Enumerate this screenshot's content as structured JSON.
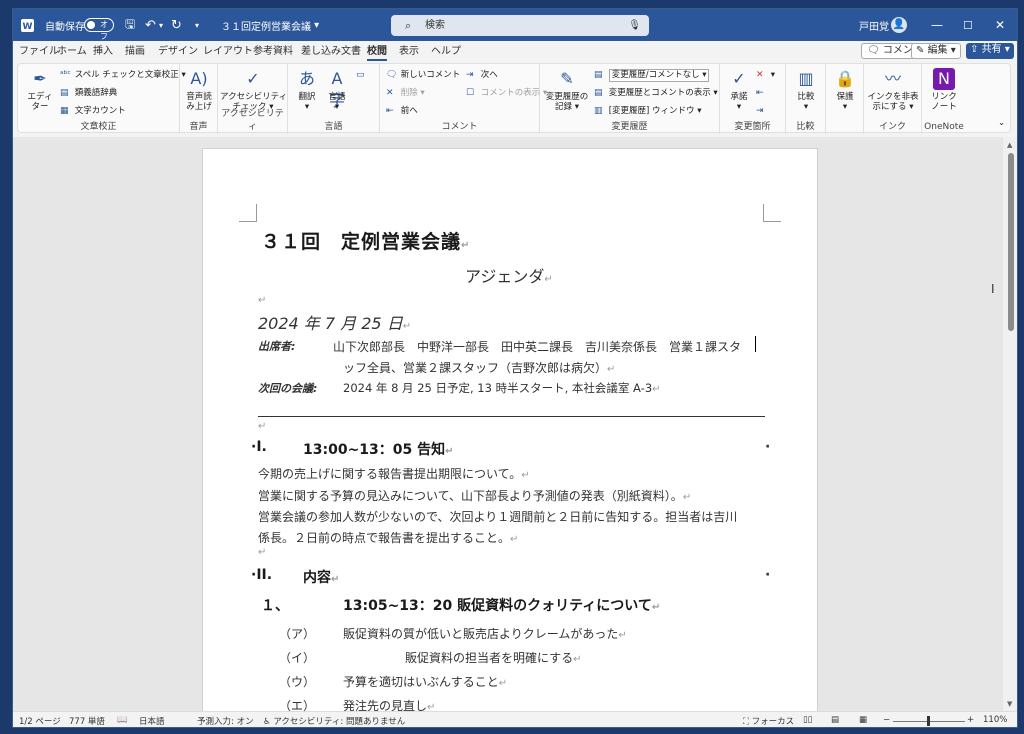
{
  "titlebar": {
    "autosave_label": "自動保存",
    "autosave_state": "オフ",
    "doc_title": "３１回定例営業会議",
    "search_placeholder": "検索",
    "user_name": "戸田覚"
  },
  "tabs": [
    "ファイル",
    "ホーム",
    "挿入",
    "描画",
    "デザイン",
    "レイアウト",
    "参考資料",
    "差し込み文書",
    "校閲",
    "表示",
    "ヘルプ"
  ],
  "active_tab": "校閲",
  "tab_actions": {
    "comment": "コメント",
    "edit": "編集",
    "share": "共有"
  },
  "ribbon": {
    "proofing": {
      "editor": "エディ\nター",
      "spell": "スペル チェックと文章校正",
      "thesaurus": "類義語辞典",
      "wordcount": "文字カウント",
      "label": "文章校正"
    },
    "speech": {
      "read": "音声読\nみ上げ",
      "label": "音声"
    },
    "access": {
      "check": "アクセシビリティ\nチェック",
      "label": "アクセシビリティ"
    },
    "language": {
      "translate": "翻訳",
      "lang": "言語",
      "label": "言語"
    },
    "comments": {
      "new": "新しいコメント",
      "delete": "削除",
      "prev": "前へ",
      "next": "次へ",
      "show": "コメントの表示",
      "label": "コメント"
    },
    "tracking": {
      "track": "変更履歴の\n記録",
      "markup_select": "変更履歴/コメントなし",
      "show_markup": "変更履歴とコメントの表示",
      "pane": "[変更履歴] ウィンドウ",
      "label": "変更履歴"
    },
    "changes": {
      "accept": "承諾",
      "label": "変更箇所"
    },
    "compare": {
      "compare": "比較",
      "label": "比較"
    },
    "protect": {
      "protect": "保護"
    },
    "ink": {
      "hide": "インクを非表\n示にする",
      "label": "インク"
    },
    "onenote": {
      "link": "リンク\nノート",
      "label": "OneNote"
    }
  },
  "doc": {
    "title": "３１回　定例営業会議",
    "subtitle": "アジェンダ",
    "date": "2024 年 7 月 25 日",
    "attendees_label": "出席者:",
    "attendees_line1": "山下次郎部長　中野洋一部長　田中英二課長　吉川美奈係長　営業１課スタ",
    "attendees_line2": "ッフ全員、営業２課スタッフ（吉野次郎は病欠）",
    "next_label": "次回の会議:",
    "next_value": "2024 年 8 月 25 日予定, 13 時半スタート, 本社会議室 A-3",
    "s1_num": "I.",
    "s1_head": "13:00~13：05 告知",
    "s1_l1": "今期の売上げに関する報告書提出期限について。",
    "s1_l2": "営業に関する予算の見込みについて、山下部長より予測値の発表（別紙資料）。",
    "s1_l3": "営業会議の参加人数が少ないので、次回より１週間前と２日前に告知する。担当者は吉川",
    "s1_l4": "係長。２日前の時点で報告書を提出すること。",
    "s2_num": "II.",
    "s2_head": "内容",
    "sub_num": "１、",
    "sub_head": "13:05~13：20 販促資料のクォリティについて",
    "items": [
      {
        "mark": "（ア）",
        "text": "販促資料の質が低いと販売店よりクレームがあった"
      },
      {
        "mark": "（イ）",
        "text": "販促資料の担当者を明確にする"
      },
      {
        "mark": "（ウ）",
        "text": "予算を適切はいぶんすること"
      },
      {
        "mark": "（エ）",
        "text": "発注先の見直し"
      }
    ]
  },
  "status": {
    "page": "1/2 ページ",
    "words": "777 単語",
    "lang": "日本語",
    "predict": "予測入力: オン",
    "access": "アクセシビリティ: 問題ありません",
    "focus": "フォーカス",
    "zoom": "110%"
  }
}
